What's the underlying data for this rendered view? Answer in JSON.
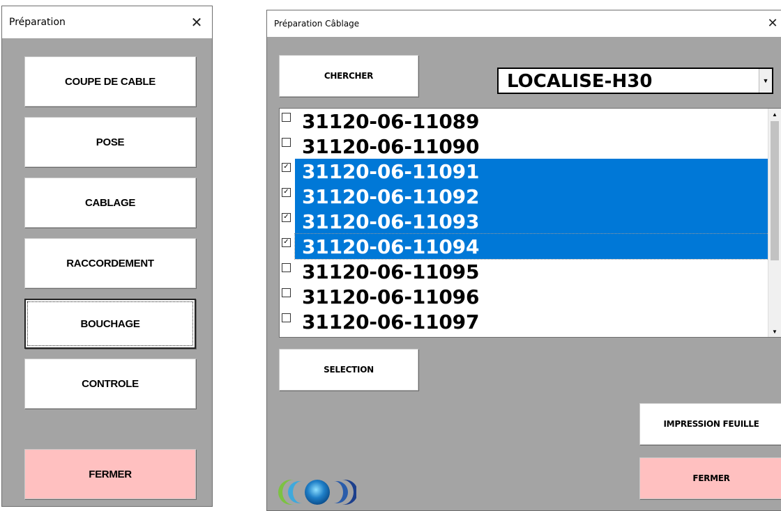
{
  "window1": {
    "title": "Préparation",
    "close_glyph": "✕",
    "buttons": {
      "coupe": "COUPE DE CABLE",
      "pose": "POSE",
      "cablage": "CABLAGE",
      "raccordement": "RACCORDEMENT",
      "bouchage": "BOUCHAGE",
      "controle": "CONTROLE",
      "fermer": "FERMER"
    }
  },
  "window2": {
    "title": "Préparation Câblage",
    "close_glyph": "✕",
    "chercher_label": "CHERCHER",
    "combo_value": "LOCALISE-H30",
    "combo_arrow": "▼",
    "list_items": [
      {
        "label": "31120-06-11089",
        "checked": false,
        "selected": false
      },
      {
        "label": "31120-06-11090",
        "checked": false,
        "selected": false
      },
      {
        "label": "31120-06-11091",
        "checked": true,
        "selected": true
      },
      {
        "label": "31120-06-11092",
        "checked": true,
        "selected": true
      },
      {
        "label": "31120-06-11093",
        "checked": true,
        "selected": true
      },
      {
        "label": "31120-06-11094",
        "checked": true,
        "selected": true
      },
      {
        "label": "31120-06-11095",
        "checked": false,
        "selected": false
      },
      {
        "label": "31120-06-11096",
        "checked": false,
        "selected": false
      },
      {
        "label": "31120-06-11097",
        "checked": false,
        "selected": false
      }
    ],
    "scroll_up": "▲",
    "scroll_down": "▼",
    "selection_label": "SELECTION",
    "impression_label": "IMPRESSION FEUILLE",
    "fermer_label": "FERMER",
    "colors": {
      "selection": "#0078d7",
      "fermer_bg": "#ffc0c0",
      "window_bg": "#a4a4a4"
    }
  }
}
